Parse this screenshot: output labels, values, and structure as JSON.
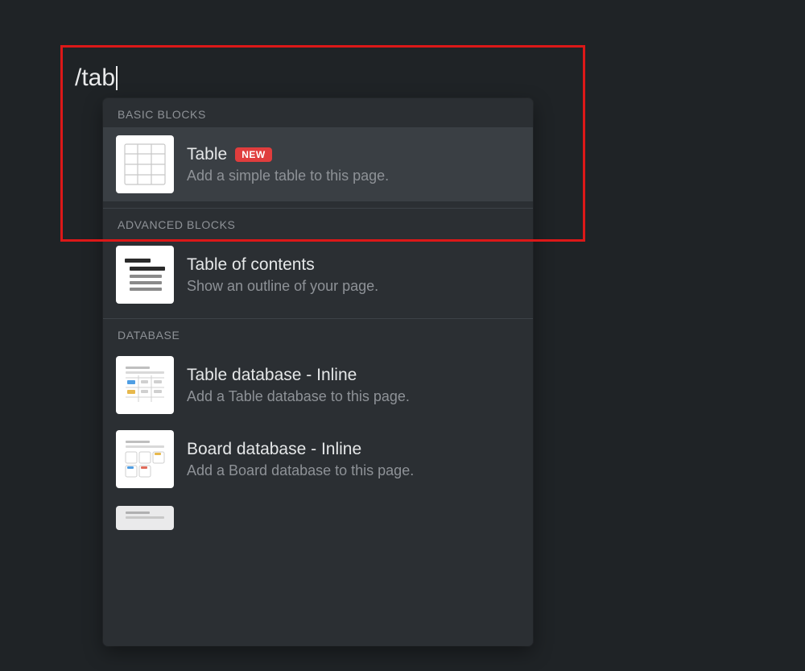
{
  "input": {
    "value": "/tab"
  },
  "popup": {
    "sections": {
      "basic": {
        "header": "BASIC BLOCKS",
        "item_table": {
          "title": "Table",
          "badge": "NEW",
          "desc": "Add a simple table to this page."
        }
      },
      "advanced": {
        "header": "ADVANCED BLOCKS",
        "item_toc": {
          "title": "Table of contents",
          "desc": "Show an outline of your page."
        }
      },
      "database": {
        "header": "DATABASE",
        "item_table_db": {
          "title": "Table database - Inline",
          "desc": "Add a Table database to this page."
        },
        "item_board_db": {
          "title": "Board database - Inline",
          "desc": "Add a Board database to this page."
        }
      }
    }
  }
}
